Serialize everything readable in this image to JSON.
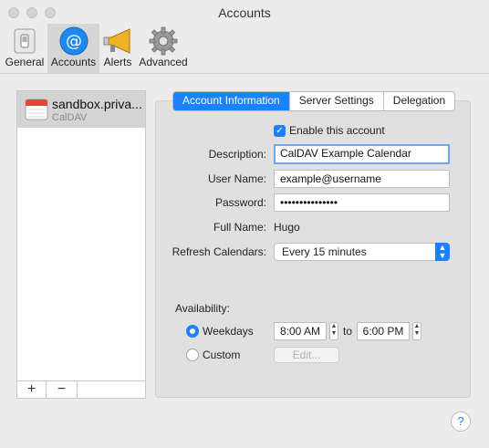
{
  "window": {
    "title": "Accounts"
  },
  "toolbar": {
    "items": [
      {
        "label": "General",
        "icon": "switch-icon"
      },
      {
        "label": "Accounts",
        "icon": "at-sign-icon",
        "selected": true
      },
      {
        "label": "Alerts",
        "icon": "megaphone-icon"
      },
      {
        "label": "Advanced",
        "icon": "gear-icon"
      }
    ]
  },
  "sidebar": {
    "accounts": [
      {
        "name": "sandbox.priva...",
        "type": "CalDAV",
        "icon": "calendar-icon"
      }
    ],
    "add_label": "+",
    "remove_label": "−"
  },
  "tabs": [
    {
      "label": "Account Information",
      "active": true
    },
    {
      "label": "Server Settings"
    },
    {
      "label": "Delegation"
    }
  ],
  "form": {
    "enable_label": "Enable this account",
    "enable_checked": true,
    "description_label": "Description:",
    "description_value": "CalDAV Example Calendar",
    "username_label": "User Name:",
    "username_value": "example@username",
    "password_label": "Password:",
    "password_value": "•••••••••••••••",
    "fullname_label": "Full Name:",
    "fullname_value": "Hugo",
    "refresh_label": "Refresh Calendars:",
    "refresh_value": "Every 15 minutes",
    "availability_label": "Availability:",
    "weekdays_label": "Weekdays",
    "weekdays_selected": true,
    "from_time": "8:00 AM",
    "to_label": "to",
    "to_time": "6:00 PM",
    "custom_label": "Custom",
    "edit_label": "Edit..."
  },
  "help_label": "?",
  "colors": {
    "accent": "#1a82fb",
    "window_bg": "#ececec",
    "panel_bg": "#e0e0e0"
  }
}
